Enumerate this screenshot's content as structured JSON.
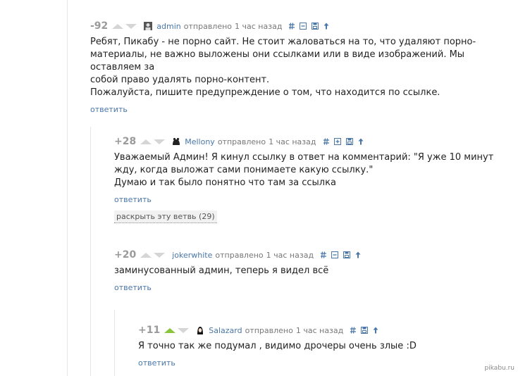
{
  "comments": [
    {
      "rating": "-92",
      "user": "admin",
      "sent": "отправлено",
      "time": "1 час назад",
      "lines": [
        "Ребят, Пикабу - не порно сайт. Не стоит жаловаться на то, что удаляют порно-",
        "материалы, не важно выложены они ссылками или в виде изображений. Мы оставляем за",
        "собой право удалять порно-контент.",
        "Пожалуйста, пишите предупреждение о том, что находится по ссылке."
      ],
      "reply": "ответить"
    },
    {
      "rating": "+28",
      "user": "Mellony",
      "sent": "отправлено",
      "time": "1 час назад",
      "lines": [
        "Уважаемый Админ! Я кинул ссылку в ответ на комментарий: \"Я уже 10 минут",
        "жду, когда выложат сами понимаете какую ссылку.\"",
        "Думаю и так было понятно что там за ссылка"
      ],
      "reply": "ответить",
      "expand": "раскрыть эту ветвь (29)"
    },
    {
      "rating": "+20",
      "user": "jokerwhite",
      "sent": "отправлено",
      "time": "1 час назад",
      "lines": [
        "заминусованный админ, теперь я видел всё"
      ],
      "reply": "ответить"
    },
    {
      "rating": "+11",
      "user": "Salazard",
      "sent": "отправлено",
      "time": "1 час назад",
      "lines": [
        "Я точно так же подумал , видимо дрочеры очень злые :D"
      ],
      "reply": "ответить"
    }
  ],
  "watermark": "pikabu.ru",
  "colors": {
    "link": "#4a76a8",
    "upvote_active": "#8ac43a",
    "vote_inactive": "#d5d5d5"
  }
}
